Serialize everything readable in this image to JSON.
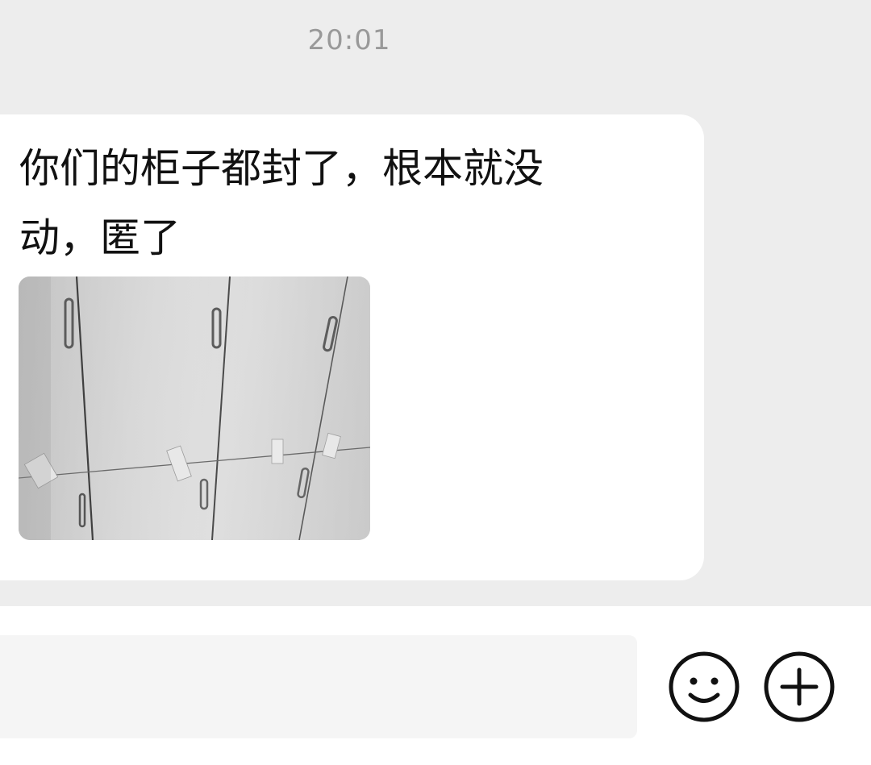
{
  "chat": {
    "timestamp": "20:01",
    "message": {
      "text": "你们的柜子都封了，根本就没动，匿了",
      "image": {
        "description_icon": "photo-thumbnail"
      }
    }
  },
  "input_bar": {
    "placeholder": "",
    "emoji_icon": "smile-icon",
    "more_icon": "plus-circle-icon"
  },
  "colors": {
    "background": "#ededed",
    "bubble": "#ffffff",
    "text": "#111111",
    "timestamp": "#999999",
    "input_field": "#f5f5f5"
  }
}
